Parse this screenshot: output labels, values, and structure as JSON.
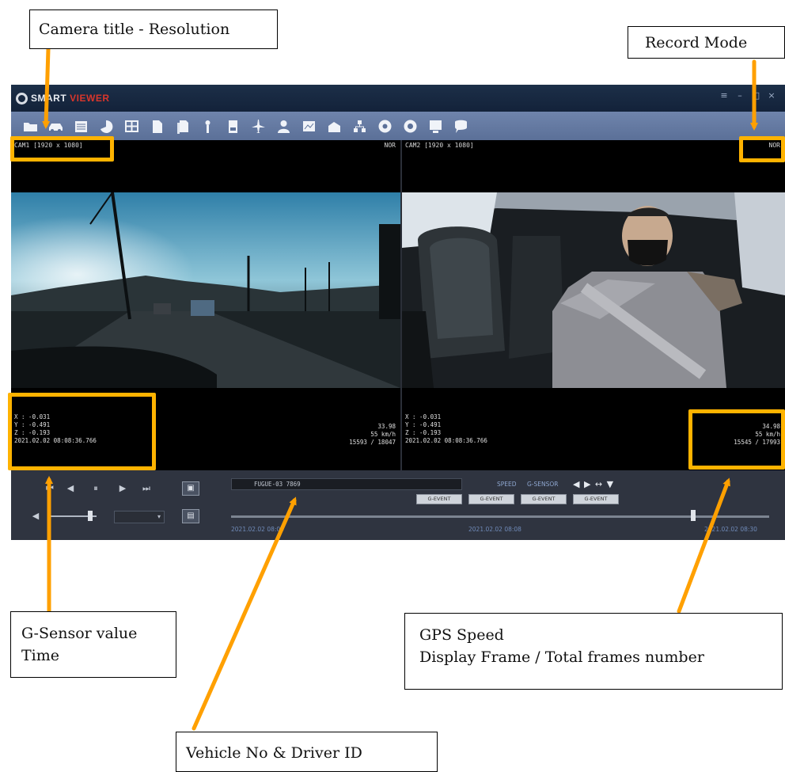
{
  "callouts": {
    "camera_title": "Camera title - Resolution",
    "record_mode": "Record Mode",
    "gsensor_line1": "G-Sensor value",
    "gsensor_line2": "Time",
    "gps_line1": "GPS Speed",
    "gps_line2": "Display Frame / Total frames number",
    "vehicle": "Vehicle No & Driver ID"
  },
  "app": {
    "logo_part1": "SMART",
    "logo_part2": "VIEWER",
    "toolbar_icons": [
      "folder-icon",
      "car-icon",
      "list-icon",
      "pie-icon",
      "grid-icon",
      "document-icon",
      "documents-icon",
      "person-icon",
      "report-icon",
      "airplane-icon",
      "user-icon",
      "map-icon",
      "building-icon",
      "network-icon",
      "dial-icon",
      "settings-icon",
      "monitor-icon",
      "chat-icon"
    ]
  },
  "left_pane": {
    "title": "CAM1 [1920 x 1080]",
    "mode": "NOR",
    "g_x": "X : -0.031",
    "g_y": "Y : -0.491",
    "g_z": "Z : -0.193",
    "time": "2021.02.02 08:08:36.766",
    "speed_value": "33.98",
    "speed_unit": "55 km/h",
    "frames": "15593 / 18047"
  },
  "right_pane": {
    "title": "CAM2 [1920 x 1080]",
    "mode": "NOR",
    "g_x": "X : -0.031",
    "g_y": "Y : -0.491",
    "g_z": "Z : -0.193",
    "time": "2021.02.02 08:08:36.766",
    "speed_value": "34.98",
    "speed_unit": "55 km/h",
    "frames": "15545 / 17993"
  },
  "controls": {
    "vehicle_no": "FUGUE-03  7869",
    "label_a": "SPEED",
    "label_b": "G-SENSOR",
    "nav": "◀ ▶ ↔ ▼",
    "event_buttons": [
      "G-EVENT",
      "G-EVENT",
      "G-EVENT",
      "G-EVENT"
    ],
    "time_start": "2021.02.02 08:00",
    "time_mid": "2021.02.02 08:08",
    "time_end": "2021.02.02 08:30",
    "speed_select": "▾"
  },
  "colors": {
    "highlight": "#ffb300",
    "toolbar": "#6479a1",
    "titlebar": "#17283f"
  }
}
